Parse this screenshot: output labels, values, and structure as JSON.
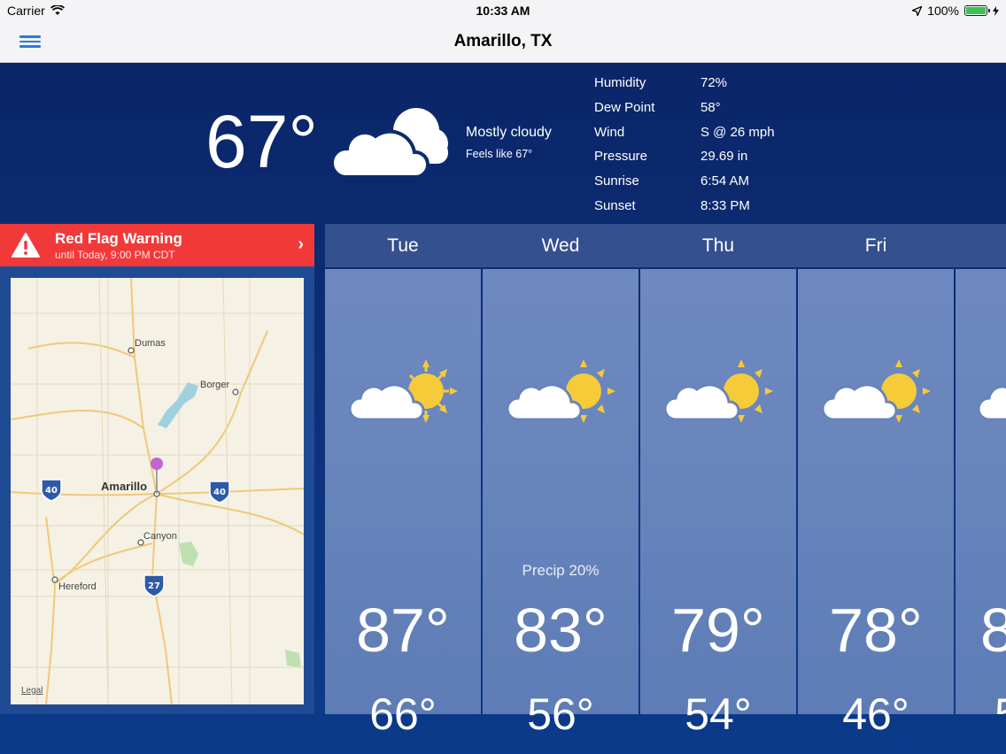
{
  "status_bar": {
    "carrier": "Carrier",
    "time": "10:33 AM",
    "battery": "100%",
    "battery_level": 1.0
  },
  "nav": {
    "title": "Amarillo, TX",
    "menu_icon": "hamburger-menu-icon"
  },
  "current": {
    "temperature": "67°",
    "condition": "Mostly cloudy",
    "feels_like": "Feels like 67°",
    "icon": "cloud-icon"
  },
  "details": [
    {
      "label": "Humidity",
      "value": "72%"
    },
    {
      "label": "Dew Point",
      "value": "58°"
    },
    {
      "label": "Wind",
      "value": "S @ 26 mph"
    },
    {
      "label": "Pressure",
      "value": "29.69 in"
    },
    {
      "label": "Sunrise",
      "value": "6:54 AM"
    },
    {
      "label": "Sunset",
      "value": "8:33 PM"
    }
  ],
  "alert": {
    "title": "Red Flag Warning",
    "subtitle": "until Today, 9:00 PM CDT",
    "color": "#f2393a"
  },
  "map": {
    "cities": {
      "dumas": "Dumas",
      "borger": "Borger",
      "amarillo": "Amarillo",
      "canyon": "Canyon",
      "hereford": "Hereford"
    },
    "shields": {
      "i40_west": "40",
      "i40_east": "40",
      "i27": "27"
    },
    "legal": "Legal"
  },
  "forecast": [
    {
      "day": "Tue",
      "high": "87°",
      "low": "66°",
      "precip": "",
      "icon": "partly-sunny-icon"
    },
    {
      "day": "Wed",
      "high": "83°",
      "low": "56°",
      "precip": "Precip 20%",
      "icon": "partly-sunny-icon"
    },
    {
      "day": "Thu",
      "high": "79°",
      "low": "54°",
      "precip": "",
      "icon": "partly-sunny-icon"
    },
    {
      "day": "Fri",
      "high": "78°",
      "low": "46°",
      "precip": "",
      "icon": "partly-sunny-icon"
    },
    {
      "day": "",
      "high": "8",
      "low": "5",
      "precip": "",
      "icon": "partly-sunny-icon"
    }
  ]
}
